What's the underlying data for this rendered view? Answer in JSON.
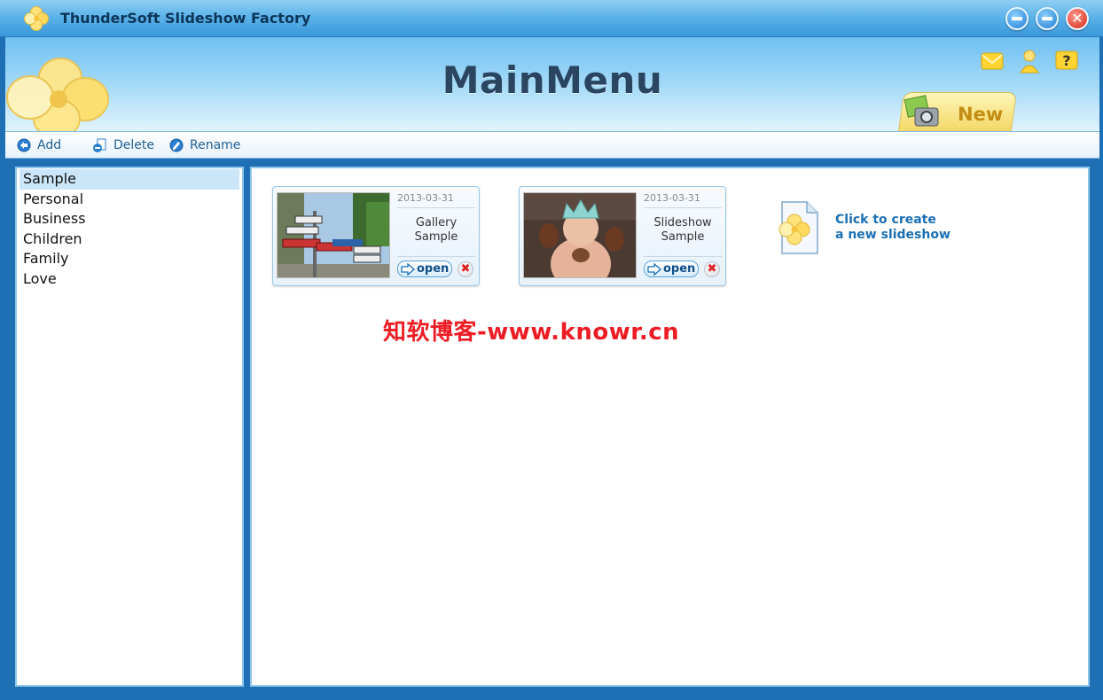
{
  "window": {
    "title": "ThunderSoft Slideshow Factory",
    "icon": "clover-logo-icon",
    "controls": [
      "minimize-icon",
      "maximize-icon",
      "close-icon"
    ]
  },
  "header": {
    "title": "MainMenu",
    "icons": [
      "message-icon",
      "user-icon",
      "help-icon"
    ],
    "new_tab_label": "New"
  },
  "toolbar": {
    "add_label": "Add",
    "delete_label": "Delete",
    "rename_label": "Rename"
  },
  "categories": {
    "items": [
      {
        "label": "Sample",
        "selected": true
      },
      {
        "label": "Personal"
      },
      {
        "label": "Business"
      },
      {
        "label": "Children"
      },
      {
        "label": "Family"
      },
      {
        "label": "Love"
      }
    ]
  },
  "slideshows": [
    {
      "date": "2013-03-31",
      "name_line1": "Gallery",
      "name_line2": "Sample",
      "open_label": "open"
    },
    {
      "date": "2013-03-31",
      "name_line1": "Slideshow",
      "name_line2": "Sample",
      "open_label": "open"
    }
  ],
  "create_new": {
    "line1": "Click to create",
    "line2": "a new slideshow"
  },
  "watermark": "知软博客-www.knowr.cn",
  "colors": {
    "accent": "#1b6fb5",
    "title_bar": "#5db4ea",
    "selection": "#cbe6f8",
    "watermark": "#ee1c24"
  }
}
